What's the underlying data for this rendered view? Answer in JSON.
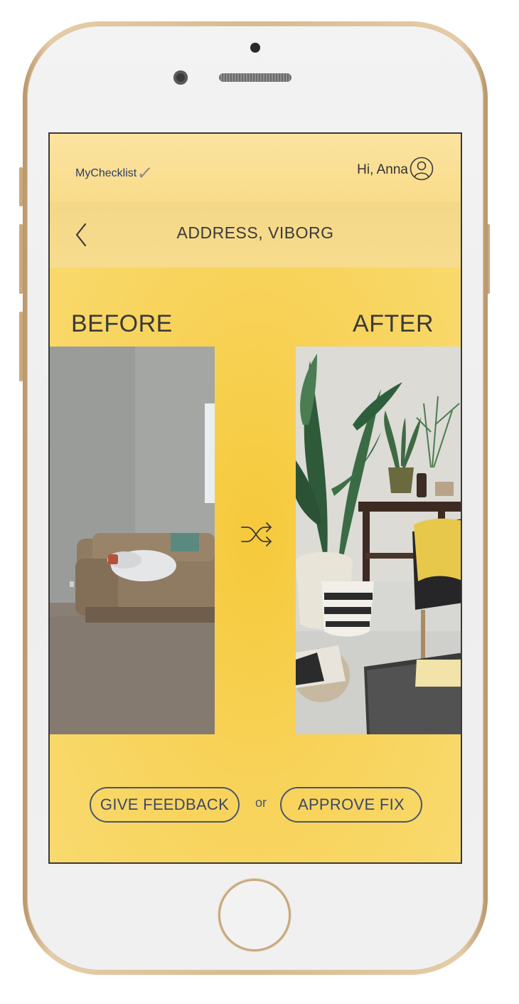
{
  "header": {
    "logo_text": "MyChecklist",
    "greeting": "Hi, Anna"
  },
  "nav": {
    "title": "ADDRESS, VIBORG"
  },
  "comparison": {
    "before_label": "BEFORE",
    "after_label": "AFTER"
  },
  "actions": {
    "feedback_label": "GIVE FEEDBACK",
    "separator": "or",
    "approve_label": "APPROVE FIX"
  },
  "colors": {
    "screen_background": "#f8d35a",
    "accent_text": "#3e4866"
  },
  "icons": {
    "avatar": "user-circle-icon",
    "back": "chevron-left-icon",
    "swap": "shuffle-icon",
    "logo_mark": "checkmark-icon"
  }
}
